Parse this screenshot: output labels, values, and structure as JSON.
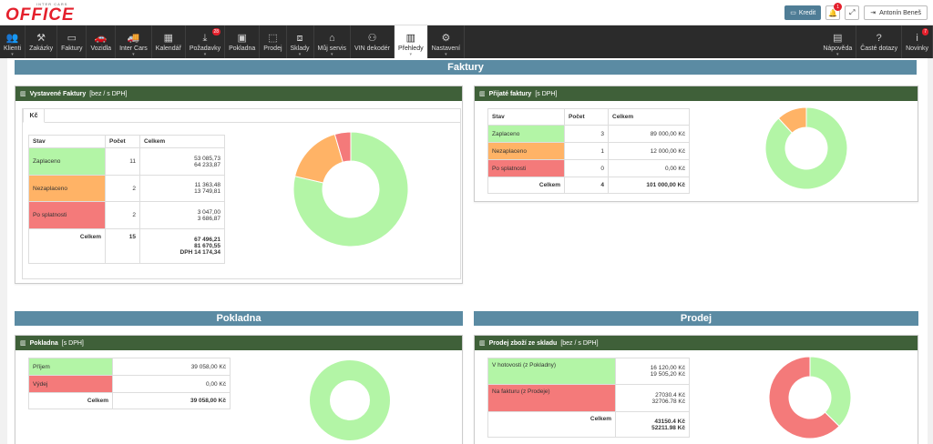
{
  "header": {
    "logo_small": "INTER CARS",
    "logo_big": "OFFICE",
    "kredit_label": "Kredit",
    "notif_count": "1",
    "user_name": "Antonín Beneš"
  },
  "nav": {
    "items": [
      {
        "label": "Klienti",
        "icon": "users-icon",
        "glyph": "👥",
        "caret": true
      },
      {
        "label": "Zakázky",
        "icon": "wrench-icon",
        "glyph": "⚒",
        "caret": false
      },
      {
        "label": "Faktury",
        "icon": "card-icon",
        "glyph": "▭",
        "caret": false
      },
      {
        "label": "Vozidla",
        "icon": "car-icon",
        "glyph": "🚗",
        "caret": false
      },
      {
        "label": "Inter Cars",
        "icon": "truck-icon",
        "glyph": "🚚",
        "caret": true
      },
      {
        "label": "Kalendář",
        "icon": "calendar-icon",
        "glyph": "▦",
        "caret": false
      },
      {
        "label": "Požadavky",
        "icon": "download-icon",
        "glyph": "⤓",
        "caret": true,
        "badge": "28"
      },
      {
        "label": "Pokladna",
        "icon": "cash-icon",
        "glyph": "▣",
        "caret": false
      },
      {
        "label": "Prodej",
        "icon": "box-icon",
        "glyph": "⬚",
        "caret": false
      },
      {
        "label": "Sklady",
        "icon": "cubes-icon",
        "glyph": "⧈",
        "caret": true
      },
      {
        "label": "Můj servis",
        "icon": "home-icon",
        "glyph": "⌂",
        "caret": true
      },
      {
        "label": "VIN dekodér",
        "icon": "binoculars-icon",
        "glyph": "⚇",
        "caret": false
      },
      {
        "label": "Přehledy",
        "icon": "bar-chart-icon",
        "glyph": "▥",
        "caret": true,
        "active": true
      },
      {
        "label": "Nastavení",
        "icon": "gear-icon",
        "glyph": "⚙",
        "caret": true
      }
    ],
    "right_items": [
      {
        "label": "Nápověda",
        "icon": "book-icon",
        "glyph": "▤",
        "caret": true
      },
      {
        "label": "Časté dotazy",
        "icon": "question-icon",
        "glyph": "?",
        "caret": false
      },
      {
        "label": "Novinky",
        "icon": "info-icon",
        "glyph": "i",
        "caret": false,
        "badge": "7"
      }
    ]
  },
  "sections": {
    "faktury": "Faktury",
    "pokladna": "Pokladna",
    "prodej": "Prodej"
  },
  "colors": {
    "green": "#b3f5a6",
    "orange": "#ffb366",
    "red": "#f47a7a",
    "panel_head": "#3f6039",
    "section": "#5b8ba3"
  },
  "vystavene": {
    "title": "Vystavené Faktury",
    "subtitle": "[bez / s DPH]",
    "tab": "Kč",
    "cols": [
      "Stav",
      "Počet",
      "Celkem"
    ],
    "rows": [
      {
        "stav": "Zaplaceno",
        "pocet": "11",
        "celkem1": "53 085,73",
        "celkem2": "64 233,87",
        "color": "green"
      },
      {
        "stav": "Nezaplaceno",
        "pocet": "2",
        "celkem1": "11 363,48",
        "celkem2": "13 749,81",
        "color": "orange"
      },
      {
        "stav": "Po splatnosti",
        "pocet": "2",
        "celkem1": "3 047,00",
        "celkem2": "3 686,87",
        "color": "red"
      }
    ],
    "sum": {
      "label": "Celkem",
      "pocet": "15",
      "celkem1": "67 496,21",
      "celkem2": "81 670,55",
      "dph": "DPH  14 174,34"
    },
    "chart_values": [
      64233.87,
      13749.81,
      3686.87
    ]
  },
  "prijate": {
    "title": "Přijaté faktury",
    "subtitle": "[s DPH]",
    "cols": [
      "Stav",
      "Počet",
      "Celkem"
    ],
    "rows": [
      {
        "stav": "Zaplaceno",
        "pocet": "3",
        "celkem": "89 000,00 Kč",
        "color": "green"
      },
      {
        "stav": "Nezaplaceno",
        "pocet": "1",
        "celkem": "12 000,00 Kč",
        "color": "orange"
      },
      {
        "stav": "Po splatnosti",
        "pocet": "0",
        "celkem": "0,00 Kč",
        "color": "red"
      }
    ],
    "sum": {
      "label": "Celkem",
      "pocet": "4",
      "celkem": "101 000,00 Kč"
    },
    "chart_values": [
      89000,
      12000,
      0
    ]
  },
  "pokladna": {
    "title": "Pokladna",
    "subtitle": "[s DPH]",
    "rows": [
      {
        "label": "Příjem",
        "value": "39 058,00 Kč",
        "color": "green"
      },
      {
        "label": "Výdej",
        "value": "0,00 Kč",
        "color": "red"
      }
    ],
    "sum": {
      "label": "Celkem",
      "value": "39 058,00 Kč"
    },
    "chart_values": [
      39058,
      0
    ]
  },
  "prodej": {
    "title": "Prodej zboží ze skladu",
    "subtitle": "[bez / s DPH]",
    "rows": [
      {
        "label": "V hotovosti (z Pokladny)",
        "v1": "16 120,00 Kč",
        "v2": "19 505,20 Kč",
        "color": "green"
      },
      {
        "label": "Na fakturu (z Prodeje)",
        "v1": "27030.4 Kč",
        "v2": "32706.78 Kč",
        "color": "red"
      }
    ],
    "sum": {
      "label": "Celkem",
      "v1": "43150.4 Kč",
      "v2": "52211.98 Kč"
    },
    "chart_values": [
      19505.2,
      32706.78
    ]
  }
}
